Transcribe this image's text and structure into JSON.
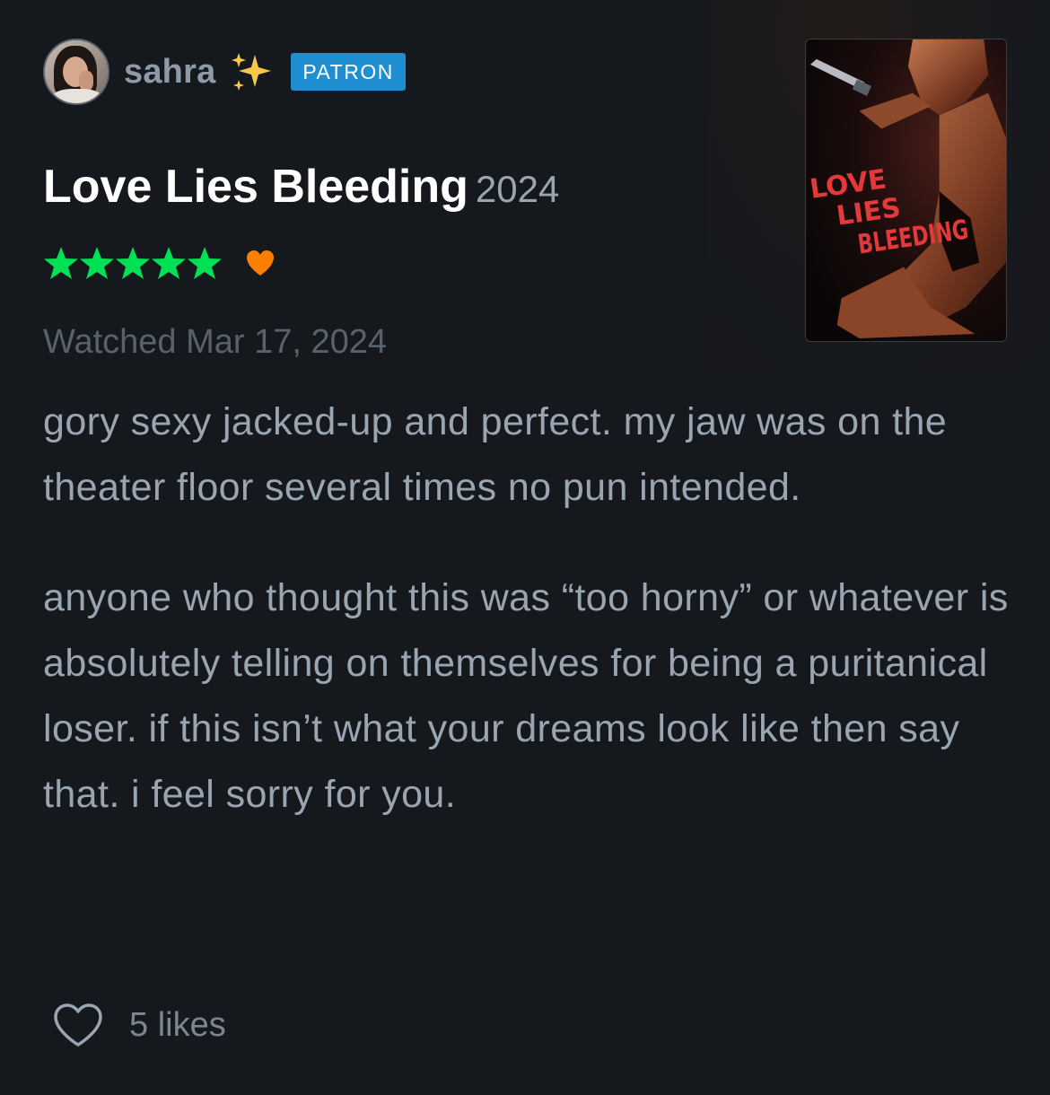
{
  "author": {
    "username": "sahra",
    "emoji": "✨",
    "badge": "PATRON",
    "avatar_icon": "user-avatar-photo"
  },
  "film": {
    "title": "Love Lies Bleeding",
    "year": "2024",
    "poster_text": [
      "LOVE",
      "LIES",
      "BLEEDING"
    ]
  },
  "rating": {
    "stars": 5,
    "max_stars": 5,
    "star_color": "#00e054",
    "liked": true,
    "heart_color": "#ff8000"
  },
  "watched": "Watched Mar 17, 2024",
  "review": {
    "paragraphs": [
      "gory sexy jacked-up and perfect. my jaw was on the theater floor several times no pun intended.",
      "anyone who thought this was “too horny” or whatever is absolutely telling on themselves for being a puritanical loser. if this isn’t what your dreams look like then say that. i feel sorry for you."
    ]
  },
  "likes": {
    "label": "5 likes",
    "icon": "heart-outline-icon"
  },
  "colors": {
    "background": "#15181d",
    "text_primary": "#ffffff",
    "text_secondary": "#9aa5b2",
    "badge": "#1f8fd1"
  }
}
